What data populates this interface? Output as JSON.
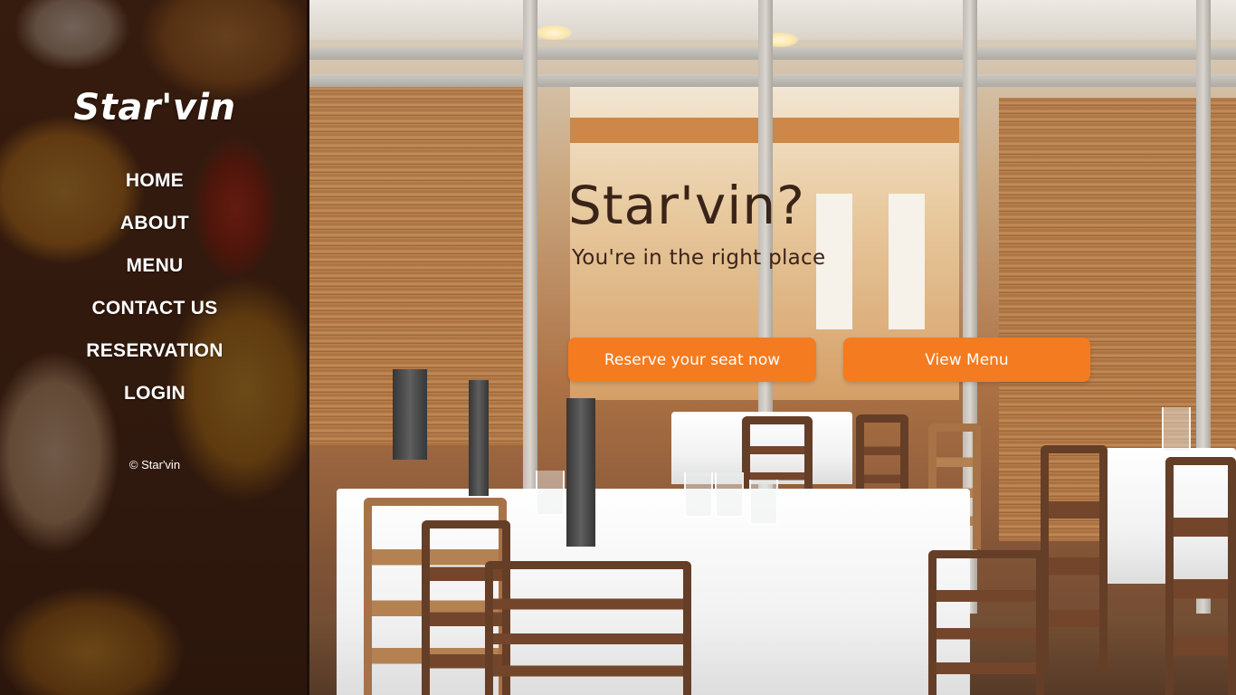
{
  "sidebar": {
    "brand": "Star'vin",
    "nav": [
      "HOME",
      "ABOUT",
      "MENU",
      "CONTACT US",
      "RESERVATION",
      "LOGIN"
    ],
    "copyright": "© Star'vin"
  },
  "hero": {
    "title": "Star'vin?",
    "subtitle": "You're in the right place",
    "buttons": {
      "reserve": "Reserve your seat now",
      "menu": "View Menu"
    }
  },
  "colors": {
    "accent": "#f47b20",
    "title_text": "#3a2418",
    "sidebar_text": "#ffffff"
  }
}
